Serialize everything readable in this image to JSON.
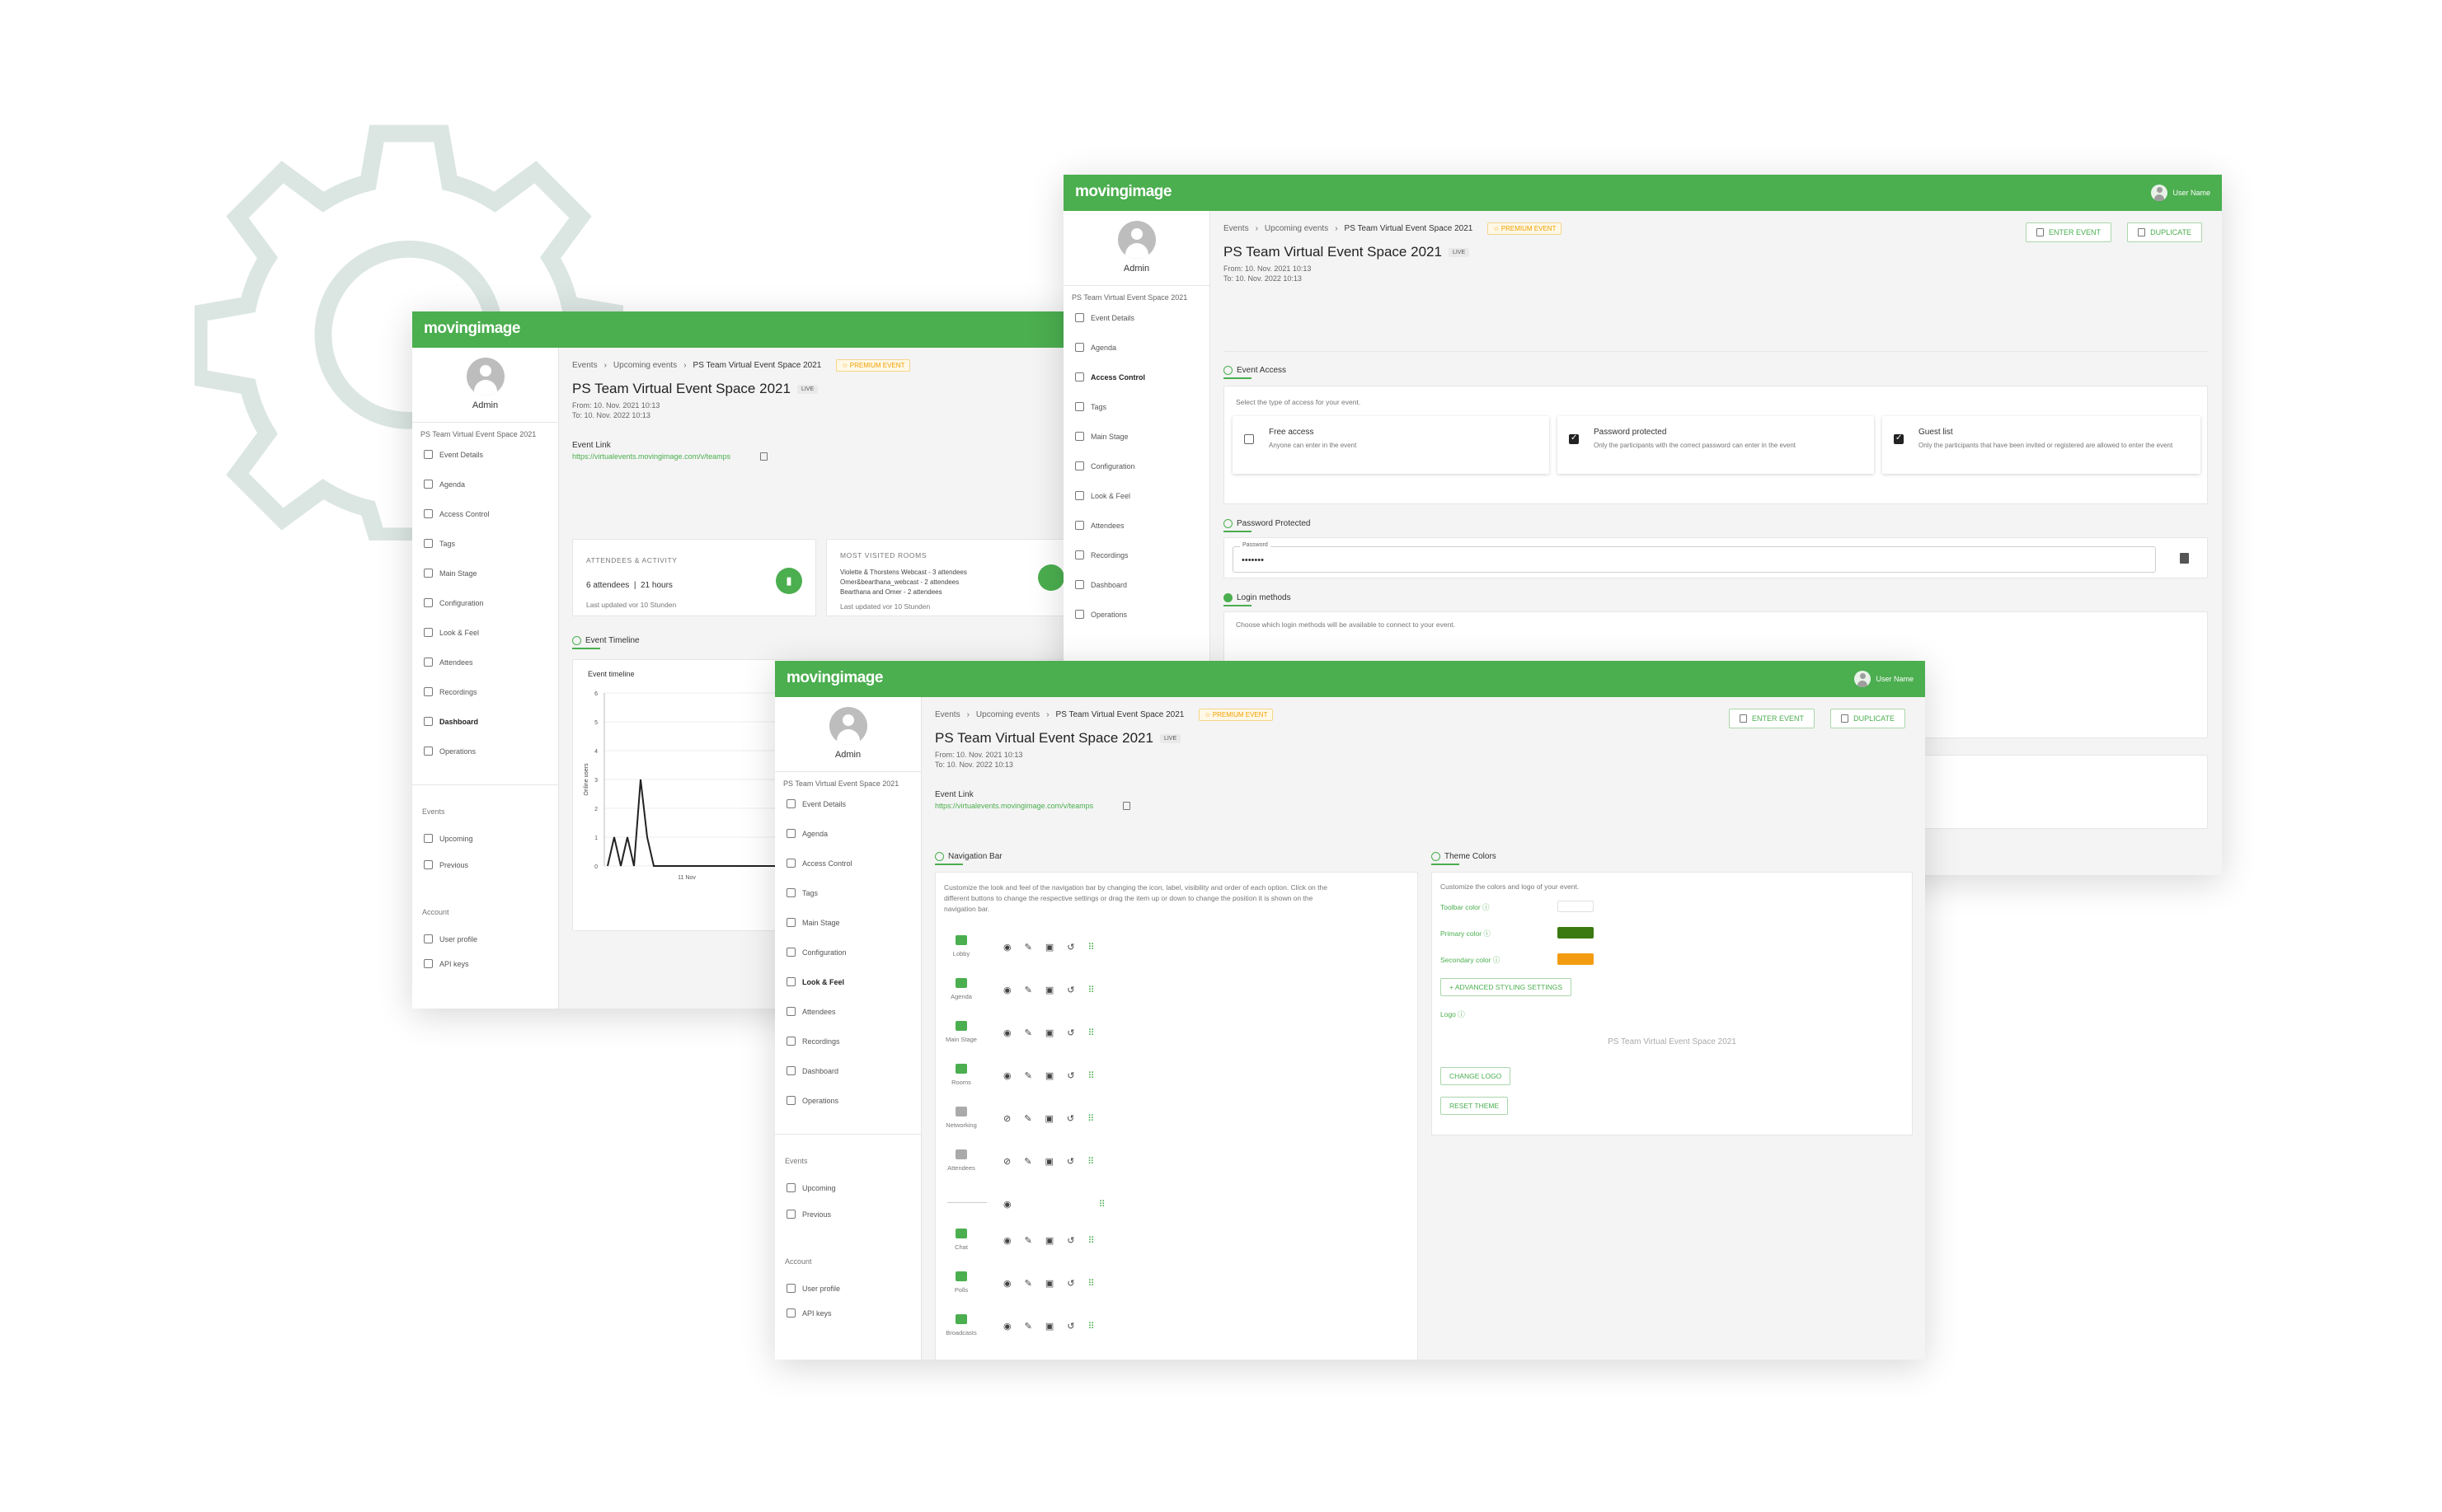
{
  "brand": {
    "logo": "movingimage",
    "primary": "#4bae4f",
    "toolbar": "#4bae4f"
  },
  "user_name": "User Name",
  "admin_label": "Admin",
  "event_name": "PS Team Virtual Event Space 2021",
  "sidebar_items": [
    "Event Details",
    "Agenda",
    "Access Control",
    "Tags",
    "Main Stage",
    "Configuration",
    "Look & Feel",
    "Attendees",
    "Recordings",
    "Dashboard",
    "Operations"
  ],
  "groups": {
    "events": "Events",
    "upcoming": "Upcoming",
    "previous": "Previous",
    "account": "Account",
    "user_profile": "User profile",
    "api_keys": "API keys"
  },
  "breadcrumb": {
    "events": "Events",
    "upcoming": "Upcoming events",
    "current": "PS Team Virtual Event Space 2021",
    "premium": "PREMIUM EVENT"
  },
  "title": "PS Team Virtual Event Space 2021",
  "live": "LIVE",
  "from": "From: 10. Nov. 2021 10:13",
  "to": "To: 10. Nov. 2022 10:13",
  "event_link_label": "Event Link",
  "event_link": "https://virtualevents.movingimage.com/v/teamps",
  "enter_event": "ENTER EVENT",
  "duplicate": "DUPLICATE",
  "dashboard": {
    "attendees_title": "ATTENDEES & ACTIVITY",
    "attendees": "6 attendees",
    "hours": "21 hours",
    "updated": "Last updated vor 10 Stunden",
    "rooms_title": "MOST VISITED ROOMS",
    "rooms": [
      "Violette & Thorstens Webcast - 3 attendees",
      "Omer&bearthana_webcast - 2 attendees",
      "Bearthana and Omer - 2 attendees"
    ],
    "rooms_updated": "Last updated vor 10 Stunden",
    "timeline_section": "Event Timeline",
    "timeline_title": "Event timeline",
    "ylabel": "Online users",
    "xtick": "11 Nov"
  },
  "chart_data": {
    "type": "line",
    "title": "Event timeline",
    "ylabel": "Online users",
    "xlabel": "",
    "x_ticks": [
      "11 Nov"
    ],
    "y_ticks": [
      0,
      1,
      2,
      3,
      4,
      5,
      6
    ],
    "ylim": [
      0,
      6
    ],
    "series": [
      {
        "values": [
          0,
          1,
          0,
          1,
          0,
          3,
          1,
          0,
          0,
          0,
          0,
          0,
          0
        ]
      }
    ]
  },
  "access": {
    "section": "Event Access",
    "select_hint": "Select the type of access for your event.",
    "options": [
      {
        "title": "Free access",
        "desc": "Anyone can enter in the event",
        "checked": false
      },
      {
        "title": "Password protected",
        "desc": "Only the participants with the correct password can enter in the event",
        "checked": true
      },
      {
        "title": "Guest list",
        "desc": "Only the participants that have been invited or registered are allowed to enter the event",
        "checked": true
      }
    ],
    "password_section": "Password Protected",
    "password_label": "Password",
    "password_value": "•••••••",
    "login_section": "Login methods",
    "login_hint": "Choose which login methods will be available to connect to your event."
  },
  "look": {
    "nav_section": "Navigation Bar",
    "nav_desc_1": "Customize the look and feel of the navigation bar by changing the icon, label, visibility and order of each option. Click on the",
    "nav_desc_2": "different buttons to change the respective settings or drag the item up or down to change the position it is shown on the",
    "nav_desc_3": "navigation bar.",
    "nav_items": [
      "Lobby",
      "Agenda",
      "Main Stage",
      "Rooms",
      "Networking",
      "Attendees",
      "",
      "Chat",
      "Polls",
      "Broadcasts"
    ],
    "theme_section": "Theme Colors",
    "theme_desc": "Customize the colors and logo of your event.",
    "toolbar_color": "Toolbar color",
    "primary_color": "Primary color",
    "secondary_color": "Secondary color",
    "primary_hex": "#3a7a10",
    "secondary_hex": "#f39c12",
    "advanced": "+ ADVANCED STYLING SETTINGS",
    "logo_label": "Logo",
    "logo_placeholder": "PS Team Virtual Event Space 2021",
    "change_logo": "CHANGE LOGO",
    "reset_theme": "RESET THEME"
  }
}
